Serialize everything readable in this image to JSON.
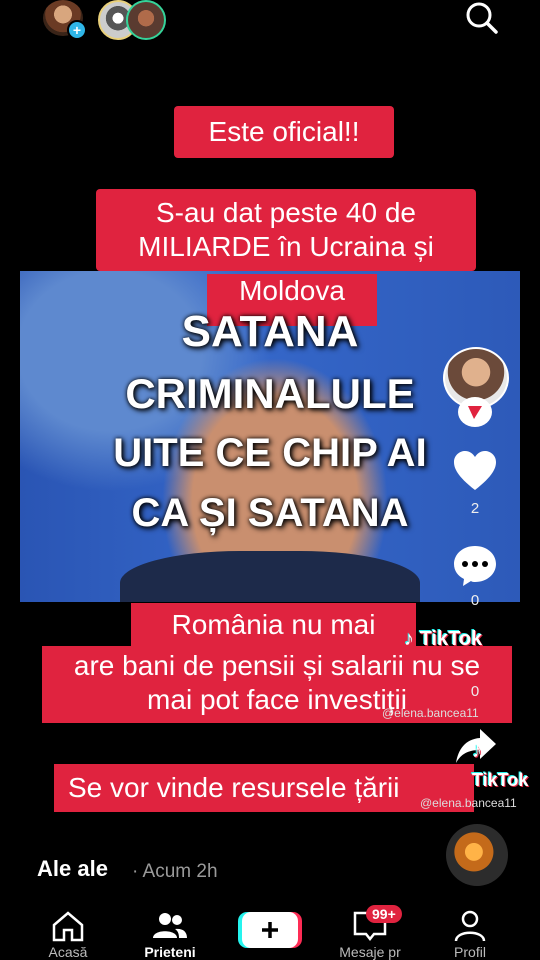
{
  "captions": {
    "c1": "Este oficial!!",
    "c2": "S-au dat peste 40 de MILIARDE în Ucraina și",
    "c2b": "Moldova",
    "c3a": "România nu mai",
    "c3b": "are bani de pensii și salarii nu se mai pot face investiții",
    "c4": "Se vor vinde resursele țării"
  },
  "overlay": {
    "line1": "SATANA",
    "line2": "CRIMINALULE",
    "line3": "UITE CE CHIP AI",
    "line4": "CA ȘI SATANA"
  },
  "actions": {
    "likes": "2",
    "comments": "0",
    "shares": "0"
  },
  "watermarks": {
    "tiktok1": "TikTok",
    "handle1": "@elena.bancea11",
    "tiktok2": "TikTok",
    "handle2": "@elena.bancea11"
  },
  "post": {
    "author": "Ale ale",
    "time": "· Acum 2h"
  },
  "nav": {
    "home": "Acasă",
    "friends": "Prieteni",
    "messages": "Mesaje pr",
    "profile": "Profil",
    "badge": "99+"
  },
  "colors": {
    "caption_red": "#e0233f",
    "accent_cyan": "#25f4ee",
    "bg": "#000000"
  }
}
